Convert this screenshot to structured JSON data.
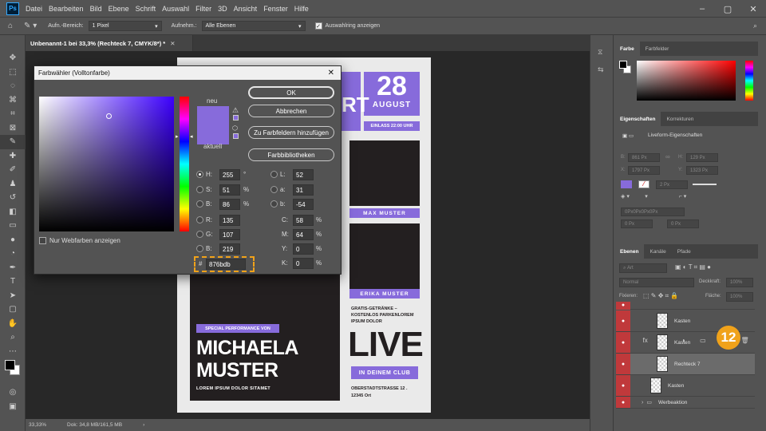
{
  "menubar": {
    "items": [
      "Datei",
      "Bearbeiten",
      "Bild",
      "Ebene",
      "Schrift",
      "Auswahl",
      "Filter",
      "3D",
      "Ansicht",
      "Fenster",
      "Hilfe"
    ],
    "logo": "Ps"
  },
  "options": {
    "size_label": "Aufn.-Bereich:",
    "size_value": "1 Pixel",
    "sample_label": "Aufnehm.:",
    "sample_value": "Alle Ebenen",
    "ring_label": "Auswahlring anzeigen"
  },
  "doc": {
    "tab": "Unbenannt-1 bei 33,3% (Rechteck 7, CMYK/8*) *",
    "zoom": "33,33%",
    "docsize": "Dok: 34,8 MB/161,5 MB"
  },
  "poster": {
    "date_num": "28",
    "date_month": "AUGUST",
    "entry": "EINLASS 22:00 UHR",
    "partial": "RT",
    "name1": "MAX MUSTER",
    "name2": "ERIKA MUSTER",
    "special": "SPECIAL PERFORMANCE VON",
    "title1": "MICHAELA",
    "title2": "MUSTER",
    "lorem": "LOREM IPSUM DOLOR SITAMET",
    "info1": "GRATIS-GETRÄNKE –",
    "info2": "KOSTENLOS PARKENLOREM",
    "info3": "IPSUM DOLOR",
    "live": "LIVE",
    "club": "IN DEINEM CLUB",
    "addr1": "OBERSTADTSTRASSE 12 .",
    "addr2": "12345 Ort"
  },
  "dialog": {
    "title": "Farbwähler (Volltonfarbe)",
    "new_label": "neu",
    "current_label": "aktuell",
    "ok": "OK",
    "cancel": "Abbrechen",
    "add_swatch": "Zu Farbfeldern hinzufügen",
    "libraries": "Farbbibliotheken",
    "web_only": "Nur Webfarben anzeigen",
    "H": "255",
    "S": "51",
    "B": "86",
    "R": "135",
    "G": "107",
    "Bv": "219",
    "L": "52",
    "a": "31",
    "b": "-54",
    "C": "58",
    "M": "64",
    "Y": "0",
    "K": "0",
    "hex": "876bdb",
    "labels": {
      "H": "H:",
      "S": "S:",
      "B": "B:",
      "R": "R:",
      "G": "G:",
      "Bv": "B:",
      "L": "L:",
      "a": "a:",
      "b": "b:",
      "C": "C:",
      "M": "M:",
      "Y": "Y:",
      "K": "K:",
      "hash": "#"
    },
    "units": {
      "deg": "°",
      "pct": "%"
    }
  },
  "panels": {
    "color_tabs": [
      "Farbe",
      "Farbfelder"
    ],
    "props_tabs": [
      "Eigenschaften",
      "Korrekturen"
    ],
    "props_title": "Liveform-Eigenschaften",
    "props_fields": {
      "w": "861 Px",
      "h": "129 Px",
      "x": "1797 Px",
      "y": "1323 Px",
      "stroke": "2 Px",
      "corner": "0 Px",
      "c1": "0 Px",
      "c2": "0 Px",
      "label": "0Px0Px0Px0Px"
    },
    "props_axis": {
      "w": "B:",
      "h": "H:",
      "x": "X:",
      "y": "Y:"
    },
    "layer_tabs": [
      "Ebenen",
      "Kanäle",
      "Pfade"
    ],
    "kind": "Art",
    "blend": "Normal",
    "opacity_label": "Deckkraft:",
    "opacity": "100%",
    "lock_label": "Fixieren:",
    "fill_label": "Fläche:",
    "fill": "100%",
    "layers": [
      "Kasten",
      "Kasten",
      "Rechteck 7",
      "Kasten",
      "Werbeaktion"
    ],
    "badge": "12"
  },
  "colors": {
    "accent": "#876bdb",
    "dark": "#231f20",
    "layer_red": "#c0393b",
    "badge": "#f0a21a"
  }
}
